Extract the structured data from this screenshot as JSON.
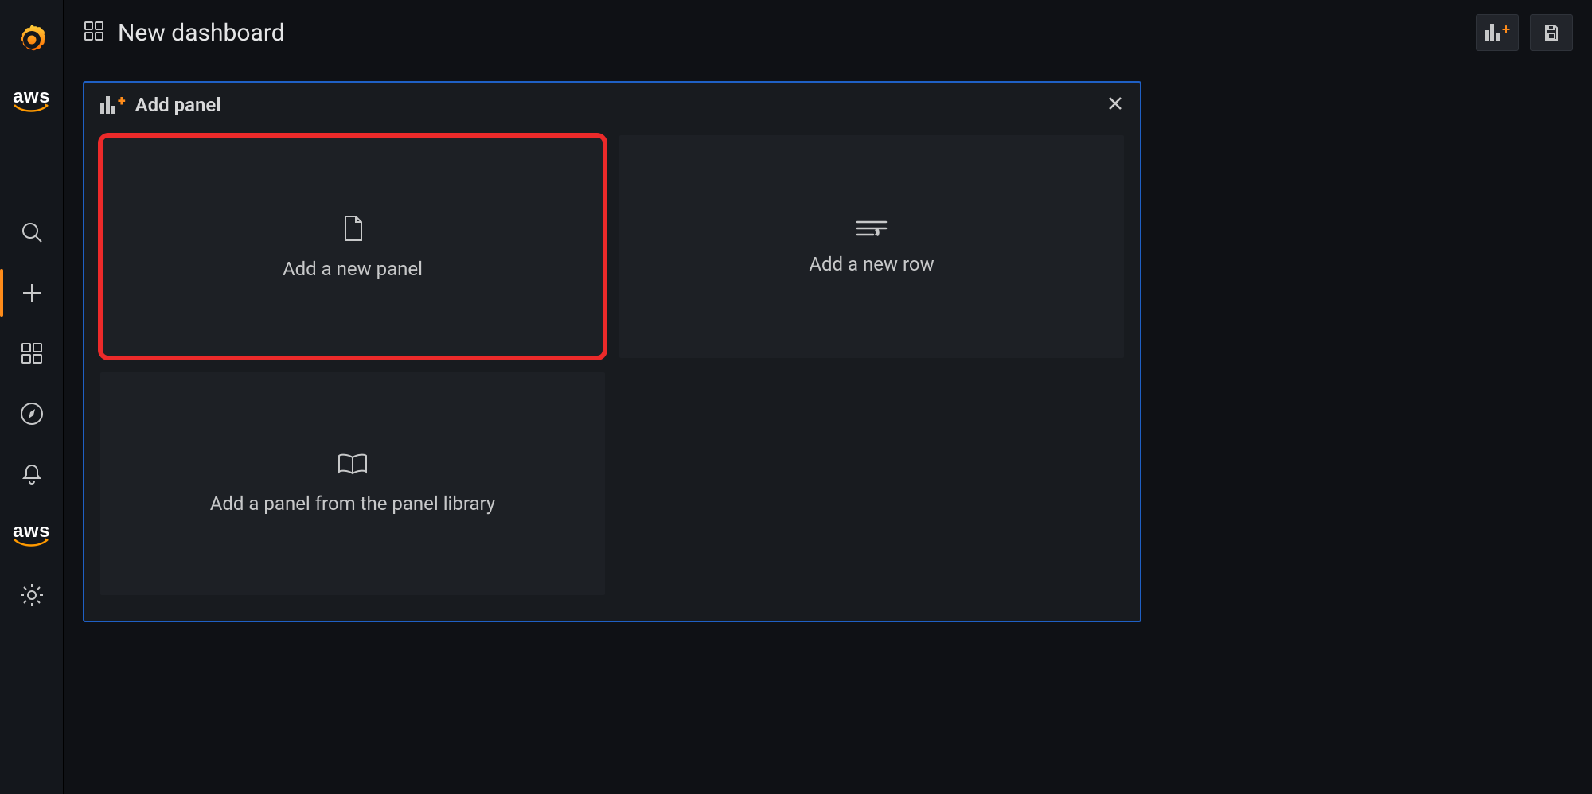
{
  "header": {
    "page_title": "New dashboard"
  },
  "toolbar": {
    "add_panel_button": "Add panel",
    "save_button": "Save dashboard"
  },
  "sidebar": {
    "items": [
      {
        "name": "grafana-logo"
      },
      {
        "name": "aws-logo",
        "label": "aws"
      },
      {
        "name": "search",
        "label": "Search"
      },
      {
        "name": "create",
        "label": "Create",
        "active": true
      },
      {
        "name": "dashboards",
        "label": "Dashboards"
      },
      {
        "name": "explore",
        "label": "Explore"
      },
      {
        "name": "alerting",
        "label": "Alerting"
      },
      {
        "name": "aws-logo-2",
        "label": "aws"
      },
      {
        "name": "configuration",
        "label": "Configuration"
      }
    ]
  },
  "add_panel": {
    "title": "Add panel",
    "close_label": "Close",
    "options": [
      {
        "id": "new-panel",
        "label": "Add a new panel",
        "highlighted": true
      },
      {
        "id": "new-row",
        "label": "Add a new row"
      },
      {
        "id": "panel-library",
        "label": "Add a panel from the panel library"
      }
    ]
  }
}
